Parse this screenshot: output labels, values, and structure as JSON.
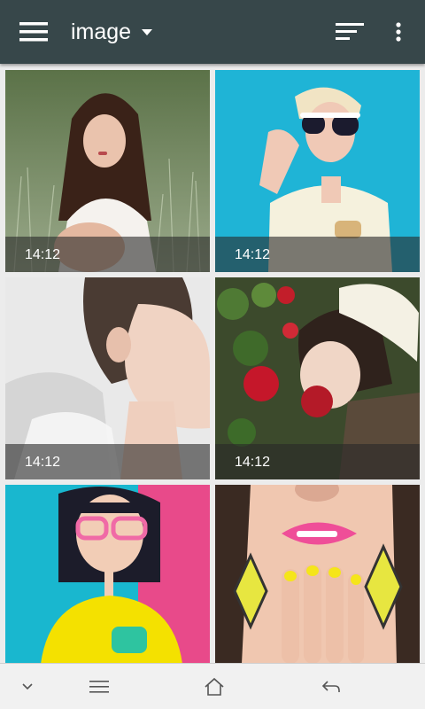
{
  "appbar": {
    "title": "image",
    "menu_icon": "hamburger-menu-icon",
    "dropdown_icon": "caret-down-icon",
    "sort_icon": "sort-lines-icon",
    "more_icon": "more-vert-icon",
    "background_color": "#37474a"
  },
  "gallery": {
    "items": [
      {
        "time": "14:12",
        "subject": "woman in grass"
      },
      {
        "time": "14:12",
        "subject": "woman with sunglasses"
      },
      {
        "time": "14:12",
        "subject": "woman side profile"
      },
      {
        "time": "14:12",
        "subject": "woman with roses and beret"
      },
      {
        "time": "",
        "subject": "woman with pink glasses"
      },
      {
        "time": "",
        "subject": "pink lips and earrings"
      }
    ]
  },
  "navbar": {
    "down_icon": "chevron-down-icon",
    "menu_icon": "menu-icon",
    "home_icon": "home-icon",
    "back_icon": "back-icon"
  }
}
